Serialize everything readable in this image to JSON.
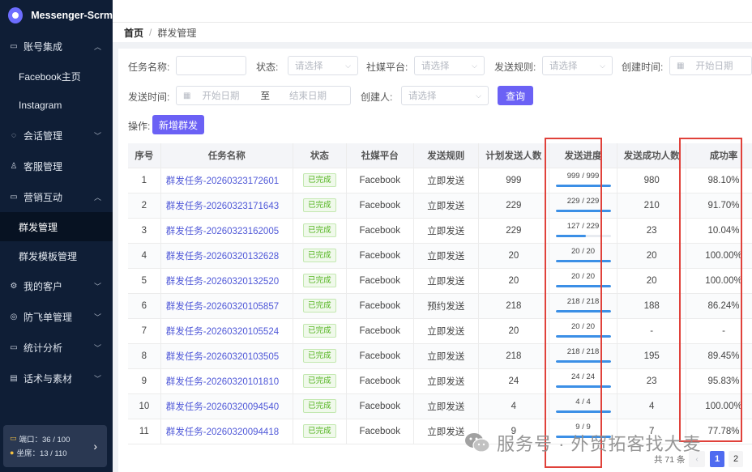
{
  "app": {
    "title": "Messenger-Scrm"
  },
  "sidebar": {
    "items": [
      {
        "label": "账号集成",
        "icon": "monitor-icon",
        "chevron": "up"
      },
      {
        "label": "Facebook主页",
        "sub": true
      },
      {
        "label": "Instagram",
        "sub": true
      },
      {
        "label": "会话管理",
        "icon": "chat-icon",
        "chevron": "down"
      },
      {
        "label": "客服管理",
        "icon": "user-icon",
        "chevron": ""
      },
      {
        "label": "营销互动",
        "icon": "monitor-icon",
        "chevron": "up"
      },
      {
        "label": "群发管理",
        "sub": true,
        "active": true
      },
      {
        "label": "群发模板管理",
        "sub": true
      },
      {
        "label": "我的客户",
        "icon": "settings-icon",
        "chevron": "down"
      },
      {
        "label": "防飞单管理",
        "icon": "compass-icon",
        "chevron": "down"
      },
      {
        "label": "统计分析",
        "icon": "monitor-icon",
        "chevron": "down"
      },
      {
        "label": "话术与素材",
        "icon": "document-icon",
        "chevron": "down"
      }
    ],
    "quota": {
      "ports": "端口：36 / 100",
      "seats": "坐席：13 / 110"
    }
  },
  "breadcrumb": {
    "home": "首页",
    "separator": "/",
    "current": "群发管理"
  },
  "filters": {
    "task_name_label": "任务名称:",
    "task_name_value": "",
    "status_label": "状态:",
    "status_placeholder": "请选择",
    "platform_label": "社媒平台:",
    "platform_placeholder": "请选择",
    "rule_label": "发送规则:",
    "rule_placeholder": "请选择",
    "created_label": "创建时间:",
    "created_start_placeholder": "开始日期",
    "send_time_label": "发送时间:",
    "send_start_placeholder": "开始日期",
    "send_to": "至",
    "send_end_placeholder": "结束日期",
    "creator_label": "创建人:",
    "creator_placeholder": "请选择",
    "query_button": "查询"
  },
  "actions": {
    "label": "操作:",
    "new_button": "新增群发"
  },
  "table": {
    "columns": [
      "序号",
      "任务名称",
      "状态",
      "社媒平台",
      "发送规则",
      "计划发送人数",
      "发送进度",
      "发送成功人数",
      "成功率"
    ],
    "rows": [
      {
        "no": "1",
        "name": "群发任务-20260323172601",
        "status": "已完成",
        "platform": "Facebook",
        "rule": "立即发送",
        "planned": "999",
        "progress": "999 / 999",
        "progress_ratio": 1.0,
        "success": "980",
        "rate": "98.10%"
      },
      {
        "no": "2",
        "name": "群发任务-20260323171643",
        "status": "已完成",
        "platform": "Facebook",
        "rule": "立即发送",
        "planned": "229",
        "progress": "229 / 229",
        "progress_ratio": 1.0,
        "success": "210",
        "rate": "91.70%"
      },
      {
        "no": "3",
        "name": "群发任务-20260323162005",
        "status": "已完成",
        "platform": "Facebook",
        "rule": "立即发送",
        "planned": "229",
        "progress": "127 / 229",
        "progress_ratio": 0.5546,
        "success": "23",
        "rate": "10.04%"
      },
      {
        "no": "4",
        "name": "群发任务-20260320132628",
        "status": "已完成",
        "platform": "Facebook",
        "rule": "立即发送",
        "planned": "20",
        "progress": "20 / 20",
        "progress_ratio": 1.0,
        "success": "20",
        "rate": "100.00%"
      },
      {
        "no": "5",
        "name": "群发任务-20260320132520",
        "status": "已完成",
        "platform": "Facebook",
        "rule": "立即发送",
        "planned": "20",
        "progress": "20 / 20",
        "progress_ratio": 1.0,
        "success": "20",
        "rate": "100.00%"
      },
      {
        "no": "6",
        "name": "群发任务-20260320105857",
        "status": "已完成",
        "platform": "Facebook",
        "rule": "预约发送",
        "planned": "218",
        "progress": "218 / 218",
        "progress_ratio": 1.0,
        "success": "188",
        "rate": "86.24%"
      },
      {
        "no": "7",
        "name": "群发任务-20260320105524",
        "status": "已完成",
        "platform": "Facebook",
        "rule": "立即发送",
        "planned": "20",
        "progress": "20 / 20",
        "progress_ratio": 1.0,
        "success": "-",
        "rate": "-"
      },
      {
        "no": "8",
        "name": "群发任务-20260320103505",
        "status": "已完成",
        "platform": "Facebook",
        "rule": "立即发送",
        "planned": "218",
        "progress": "218 / 218",
        "progress_ratio": 1.0,
        "success": "195",
        "rate": "89.45%"
      },
      {
        "no": "9",
        "name": "群发任务-20260320101810",
        "status": "已完成",
        "platform": "Facebook",
        "rule": "立即发送",
        "planned": "24",
        "progress": "24 / 24",
        "progress_ratio": 1.0,
        "success": "23",
        "rate": "95.83%"
      },
      {
        "no": "10",
        "name": "群发任务-20260320094540",
        "status": "已完成",
        "platform": "Facebook",
        "rule": "立即发送",
        "planned": "4",
        "progress": "4 / 4",
        "progress_ratio": 1.0,
        "success": "4",
        "rate": "100.00%"
      },
      {
        "no": "11",
        "name": "群发任务-20260320094418",
        "status": "已完成",
        "platform": "Facebook",
        "rule": "立即发送",
        "planned": "9",
        "progress": "9 / 9",
        "progress_ratio": 1.0,
        "success": "7",
        "rate": "77.78%"
      }
    ]
  },
  "pagination": {
    "total": "共 71 条",
    "pages": [
      "1",
      "2"
    ],
    "current": "1"
  },
  "watermark": {
    "text": "服务号 · 外贸拓客找大麦"
  },
  "colors": {
    "sidebar_bg": "#0f1e36",
    "accent": "#6b61f5",
    "link": "#4f58d8",
    "progress": "#3b8fe6",
    "highlight": "#e0413a",
    "status_green": "#52b41e"
  }
}
